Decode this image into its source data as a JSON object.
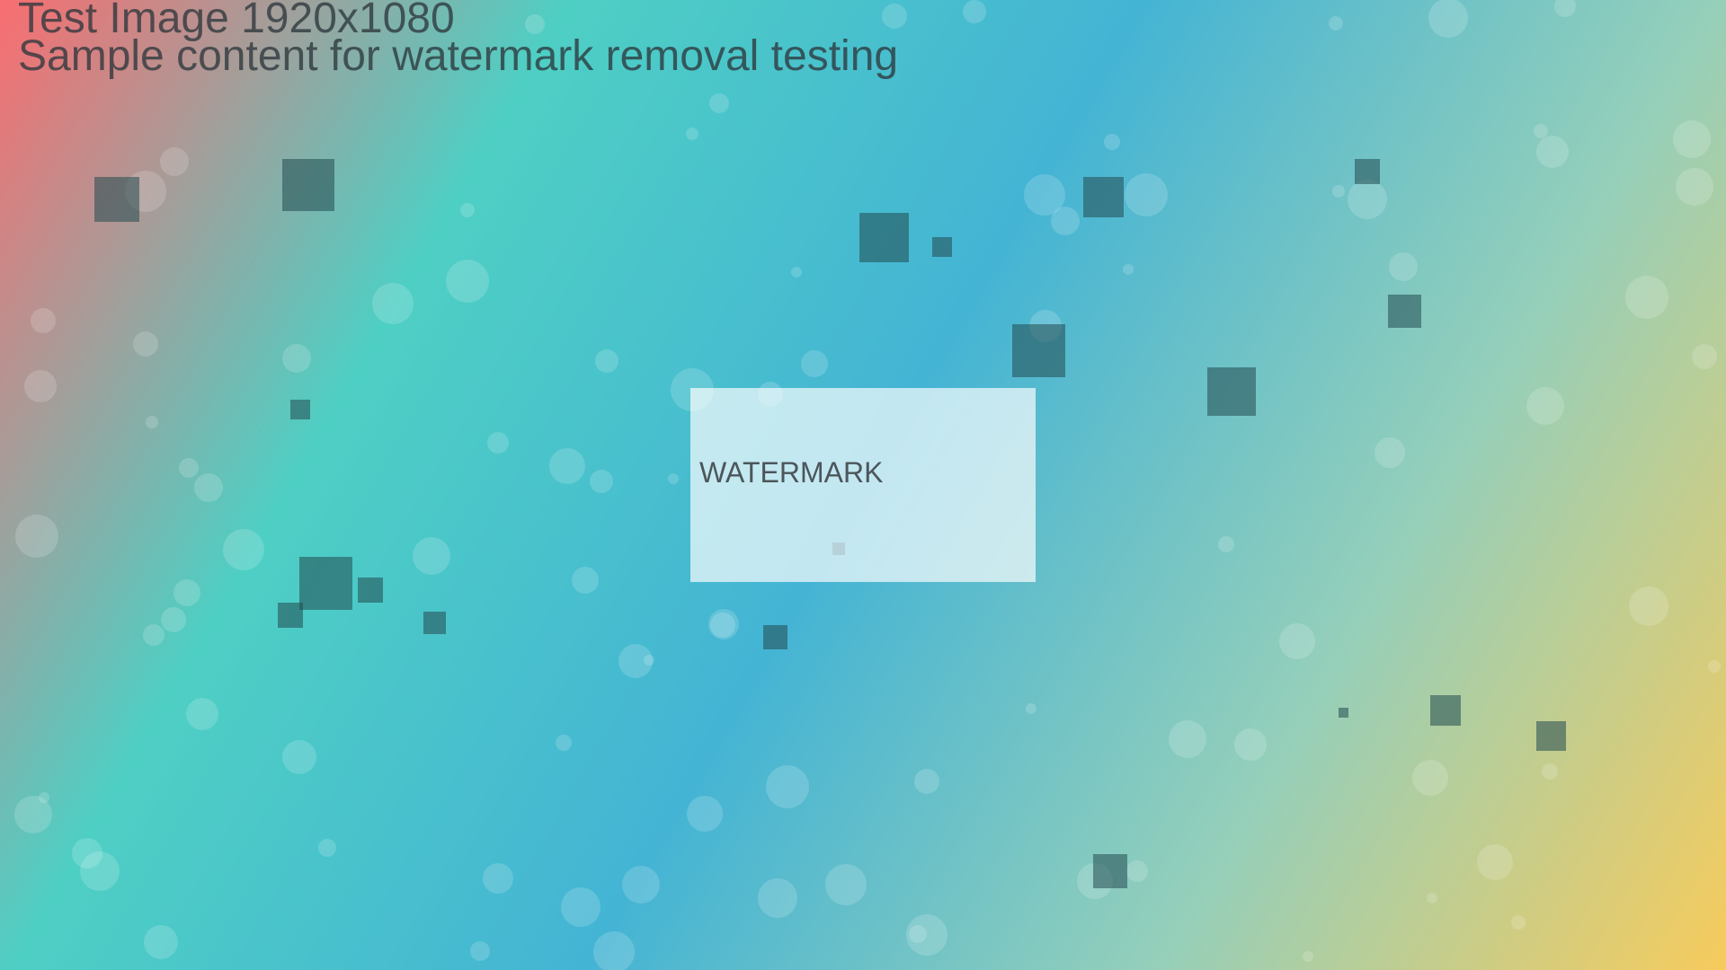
{
  "header": {
    "title": "Test Image 1920x1080",
    "subtitle": "Sample content for watermark removal testing"
  },
  "watermark": {
    "label": "WATERMARK"
  },
  "colors": {
    "gradient_stops": [
      "#f96d70",
      "#4ecfc4",
      "#44b4d4",
      "#95cfba",
      "#f7cb5c"
    ]
  }
}
